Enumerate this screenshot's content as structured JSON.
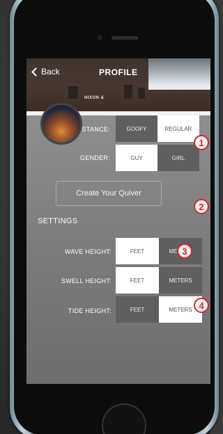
{
  "header": {
    "back_label": "Back",
    "title": "PROFILE",
    "photo_sign": "NIXON &"
  },
  "profile": {
    "stance": {
      "label": "STANCE:",
      "options": [
        "GOOFY",
        "REGULAR"
      ],
      "selected": "REGULAR"
    },
    "gender": {
      "label": "GENDER:",
      "options": [
        "GUY",
        "GIRL"
      ],
      "selected": "GUY"
    },
    "quiver_button": "Create Your Quiver"
  },
  "settings": {
    "heading": "SETTINGS",
    "wave_height": {
      "label": "WAVE HEIGHT:",
      "options": [
        "FEET",
        "METERS"
      ],
      "selected": "FEET"
    },
    "swell_height": {
      "label": "SWELL HEIGHT:",
      "options": [
        "FEET",
        "METERS"
      ],
      "selected": "FEET"
    },
    "tide_height": {
      "label": "TIDE HEIGHT:",
      "options": [
        "FEET",
        "METERS"
      ],
      "selected": "METERS"
    }
  },
  "annotations": [
    "1",
    "2",
    "3",
    "4"
  ],
  "colors": {
    "callout_red": "#d9232b",
    "selected_bg": "#ffffff",
    "unselected_bg": "#5f5f5f"
  },
  "icons": {
    "back": "chevron-left-icon",
    "avatar": "profile-photo",
    "home": "home-button"
  }
}
